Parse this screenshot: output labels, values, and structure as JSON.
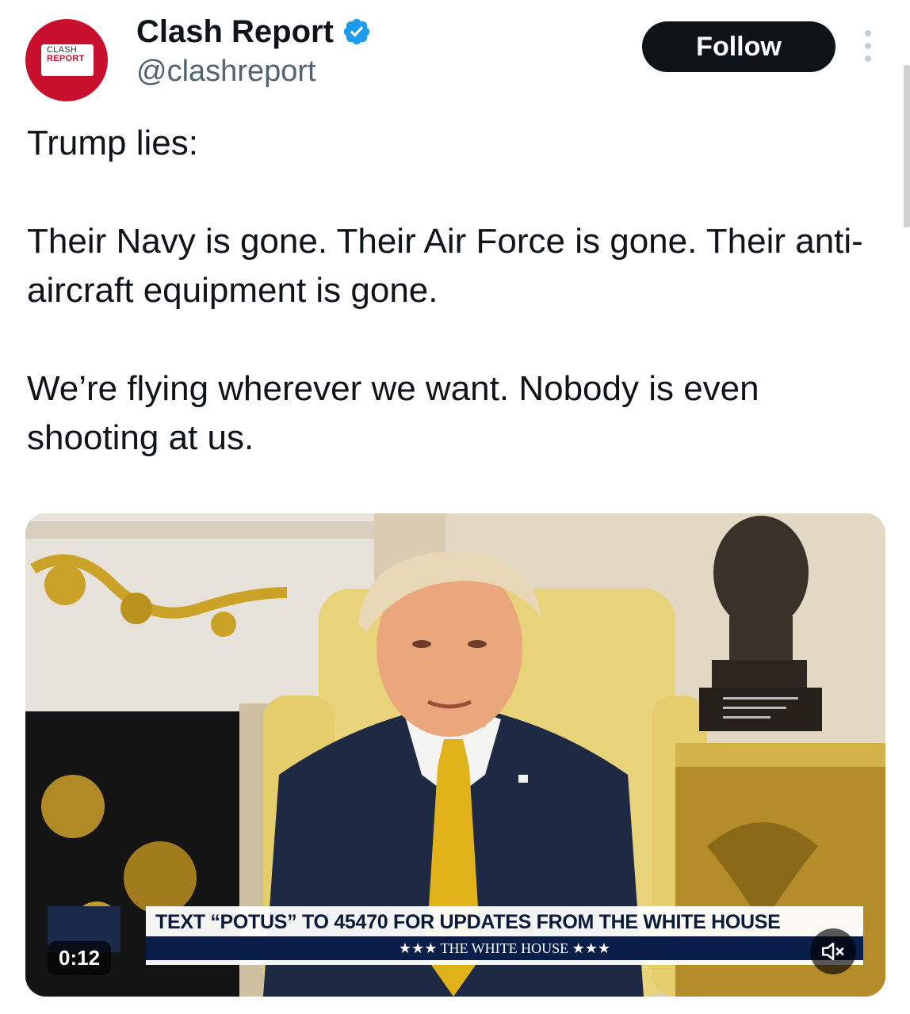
{
  "author": {
    "display_name": "Clash Report",
    "handle": "@clashreport",
    "verified": true,
    "avatar_logo_line1": "CLASH",
    "avatar_logo_line2": "REPORT",
    "avatar_color": "#c8102e"
  },
  "actions": {
    "follow_label": "Follow",
    "more_icon": "more-vertical-icon"
  },
  "tweet": {
    "text": "Trump lies:\n\nTheir Navy is gone. Their Air Force is gone. Their anti-aircraft equipment is gone.\n\nWe’re flying wherever we want. Nobody is even shooting at us."
  },
  "video": {
    "timestamp": "0:12",
    "banner_text": "TEXT “POTUS” TO 45470 FOR UPDATES FROM THE WHITE HOUSE",
    "banner_sub": "★★★  THE WHITE HOUSE  ★★★",
    "mute_icon": "speaker-muted-icon"
  },
  "colors": {
    "verified_blue": "#1d9bf0",
    "follow_bg": "#0f1419",
    "handle_gray": "#536471"
  }
}
